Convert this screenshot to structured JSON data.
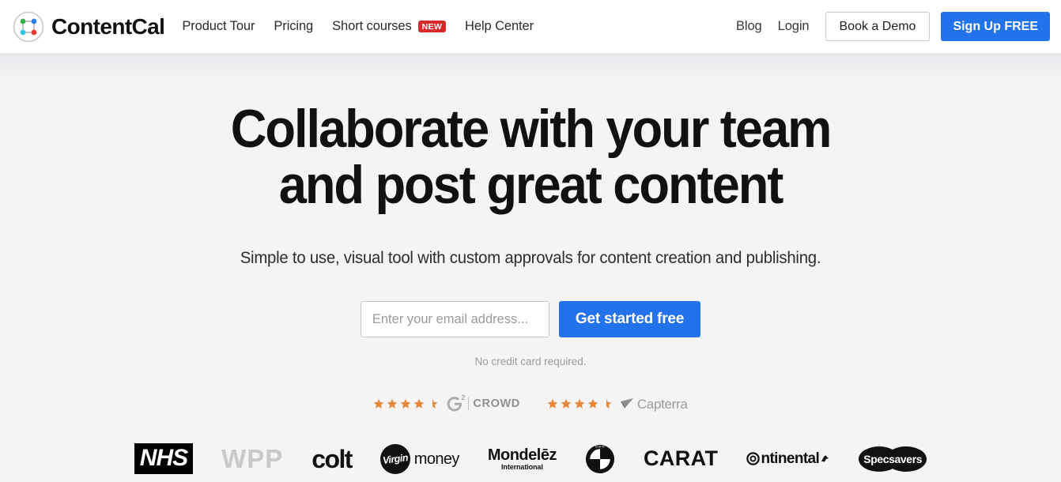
{
  "header": {
    "brand": {
      "name": "ContentCal",
      "mark_colors": {
        "top_left": "#36b24a",
        "top_right": "#2f7ff0",
        "bottom_left": "#2ec8e6",
        "bottom_right": "#e53b2e",
        "ring": "#c9c9c9",
        "line": "#b5b5b5"
      }
    },
    "nav": [
      {
        "label": "Product Tour",
        "badge": null
      },
      {
        "label": "Pricing",
        "badge": null
      },
      {
        "label": "Short courses",
        "badge": "NEW"
      },
      {
        "label": "Help Center",
        "badge": null
      }
    ],
    "right_links": [
      {
        "label": "Blog"
      },
      {
        "label": "Login"
      }
    ],
    "demo_button": "Book a Demo",
    "signup_button": "Sign Up FREE",
    "accent_blue": "#2272eb",
    "badge_red": "#d8292a"
  },
  "hero": {
    "title_line1": "Collaborate with your team",
    "title_line2": "and post great content",
    "subtitle": "Simple to use, visual tool with custom approvals for content creation and publishing.",
    "email_placeholder": "Enter your email address...",
    "email_value": "",
    "cta_label": "Get started free",
    "disclaimer": "No credit card required."
  },
  "reviews": {
    "star_color": "#e8883a",
    "items": [
      {
        "rating": 4.5,
        "max": 5,
        "source": "G2 Crowd",
        "logo_letter": "G",
        "logo_superscript": "2",
        "logo_word": "CROWD"
      },
      {
        "rating": 4.5,
        "max": 5,
        "source": "Capterra",
        "logo_word": "Capterra"
      }
    ]
  },
  "clients": [
    {
      "name": "NHS",
      "label": "NHS"
    },
    {
      "name": "WPP",
      "label": "WPP"
    },
    {
      "name": "Colt",
      "label": "colt"
    },
    {
      "name": "Virgin Money",
      "label": "Virgin",
      "label2": "money"
    },
    {
      "name": "Mondelez International",
      "label": "Mondelēz",
      "label2": "International"
    },
    {
      "name": "BMW",
      "label": "BMW"
    },
    {
      "name": "Carat",
      "label": "CARAT"
    },
    {
      "name": "Continental",
      "label": "ntinental"
    },
    {
      "name": "Specsavers",
      "label": "Specsavers"
    }
  ]
}
